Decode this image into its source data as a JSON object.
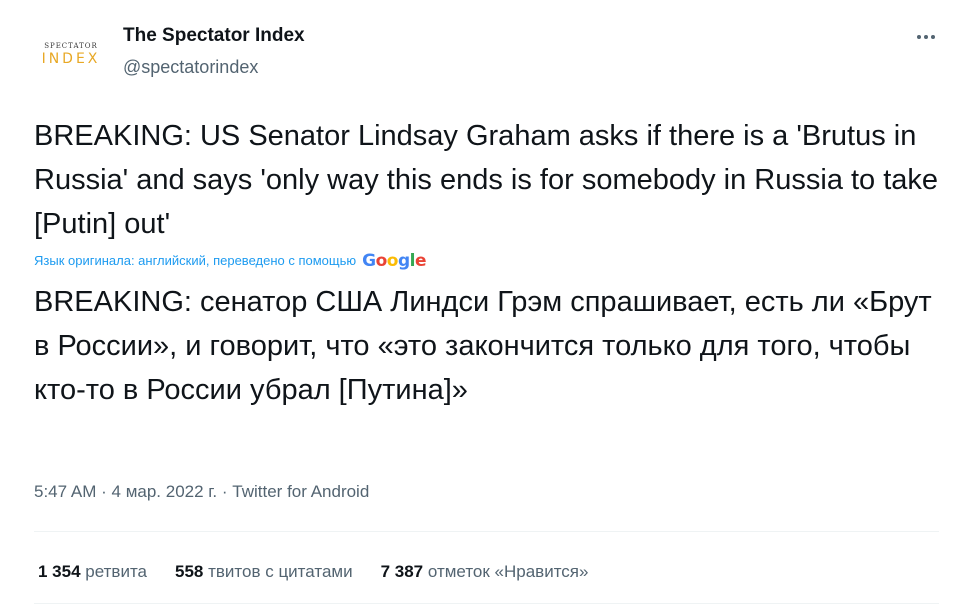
{
  "account": {
    "avatar_small": "SPECTATOR",
    "avatar_big": "INDEX",
    "display_name": "The Spectator Index",
    "handle": "@spectatorindex"
  },
  "tweet": {
    "text": "BREAKING: US Senator Lindsay Graham asks if there is a 'Brutus in Russia' and says 'only way this ends is for somebody in Russia to take [Putin] out'",
    "translation_note": "Язык оригинала: английский, переведено с помощью",
    "translation_provider": "Google",
    "translated_text": "BREAKING: сенатор США Линдси Грэм спрашивает, есть ли «Брут в России», и говорит, что «это закончится только для того, чтобы кто-то в России убрал [Путина]»",
    "time": "5:47 AM",
    "date": "4 мар. 2022 г.",
    "source": "Twitter for Android",
    "separator": "·"
  },
  "stats": {
    "retweets_count": "1 354",
    "retweets_label": "ретвита",
    "quotes_count": "558",
    "quotes_label": "твитов с цитатами",
    "likes_count": "7 387",
    "likes_label": "отметок «Нравится»"
  },
  "icons": {
    "more": "more-horizontal-icon"
  },
  "colors": {
    "link": "#1d9bf0",
    "secondary_text": "#536471",
    "primary_text": "#0f1419",
    "logo_accent": "#e8a825"
  }
}
